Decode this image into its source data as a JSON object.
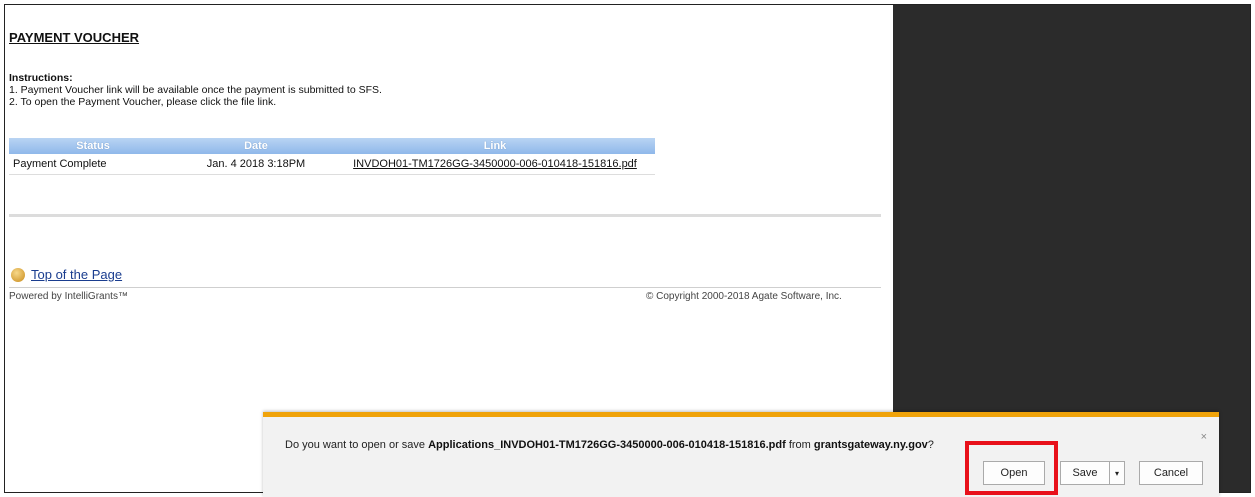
{
  "page": {
    "heading": "PAYMENT VOUCHER",
    "instructions_title": "Instructions:",
    "instruction_1": "1. Payment Voucher link will be available once the payment is submitted to SFS.",
    "instruction_2": "2. To open the Payment Voucher, please click the file link."
  },
  "table": {
    "headers": [
      "Status",
      "Date",
      "Link"
    ],
    "rows": [
      {
        "status": "Payment Complete",
        "date": "Jan. 4 2018 3:18PM",
        "link": "INVDOH01-TM1726GG-3450000-006-010418-151816.pdf"
      }
    ]
  },
  "footer": {
    "top_link": "Top of the Page",
    "powered_by": "Powered by IntelliGrants™",
    "copyright": "© Copyright 2000-2018 Agate Software, Inc."
  },
  "download_bar": {
    "prefix": "Do you want to open or save ",
    "filename": "Applications_INVDOH01-TM1726GG-3450000-006-010418-151816.pdf",
    "middle": " from ",
    "source": "grantsgateway.ny.gov",
    "suffix": "?",
    "open_label": "Open",
    "save_label": "Save",
    "save_arrow": "▾",
    "cancel_label": "Cancel",
    "close_glyph": "×"
  },
  "icons": {
    "close": "close-icon",
    "dropdown": "chevron-down-icon",
    "bullet": "orange-circle-icon"
  },
  "colors": {
    "accent_bar": "#f0a30a",
    "table_header": "#8fb8ea",
    "highlight": "#e8101a",
    "dark_panel": "#2b2b2b"
  }
}
